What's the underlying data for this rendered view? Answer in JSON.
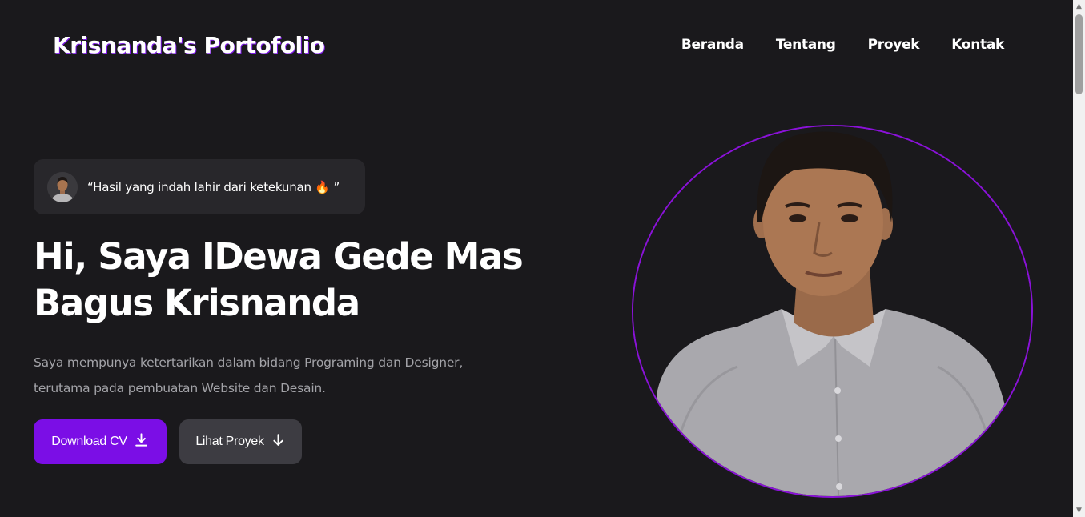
{
  "header": {
    "brand": "Krisnanda's Portofolio",
    "nav": [
      "Beranda",
      "Tentang",
      "Proyek",
      "Kontak"
    ]
  },
  "hero": {
    "quote": "“Hasil yang indah lahir dari ketekunan 🔥 ”",
    "title_line1": "Hi, Saya IDewa Gede Mas",
    "title_line2": "Bagus Krisnanda",
    "description_line1": "Saya mempunya ketertarikan dalam bidang Programing dan Designer,",
    "description_line2": "terutama pada pembuatan Website dan Desain.",
    "buttons": {
      "download_cv": "Download CV",
      "view_projects": "Lihat Proyek"
    }
  },
  "icons": {
    "download": "download-icon",
    "arrow_down": "arrow-down-icon",
    "avatar": "avatar",
    "portrait": "profile-portrait"
  },
  "colors": {
    "background": "#1a191c",
    "accent": "#7b0ee6",
    "secondary_button": "#3d3c42",
    "quote_pill": "#28272b",
    "muted_text": "#a3a3a8"
  }
}
